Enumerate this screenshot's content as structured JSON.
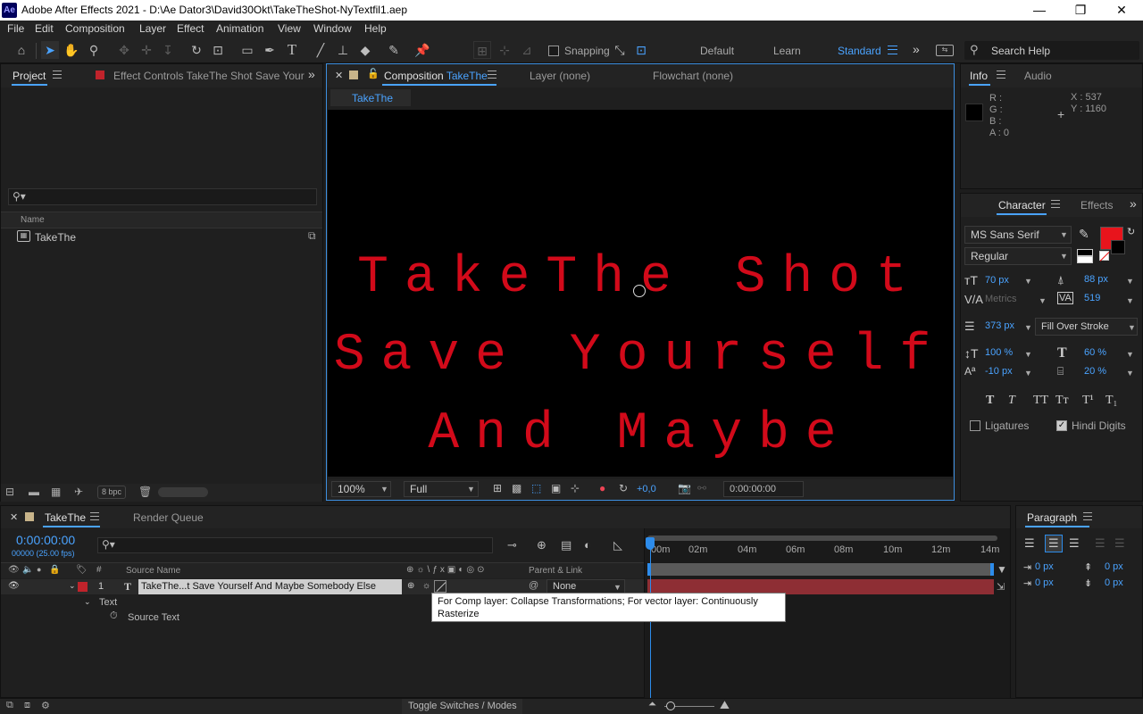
{
  "window": {
    "app_logo": "Ae",
    "title": "Adobe After Effects 2021 - D:\\Ae Dator3\\David30Okt\\TakeTheShot-NyTextfil1.aep",
    "minimize": "—",
    "restore": "❐",
    "close": "✕"
  },
  "menu": [
    "File",
    "Edit",
    "Composition",
    "Layer",
    "Effect",
    "Animation",
    "View",
    "Window",
    "Help"
  ],
  "toolbar": {
    "snapping_label": "Snapping",
    "workspaces": [
      "Default",
      "Learn",
      "Standard"
    ],
    "more": "»",
    "search_placeholder": "Search Help"
  },
  "project_panel": {
    "tab_project": "Project",
    "tab_effect_controls": "Effect Controls TakeThe Shot Save Your",
    "search_placeholder": "",
    "column_name": "Name",
    "items": [
      {
        "name": "TakeThe"
      }
    ],
    "bpc": "8 bpc"
  },
  "composition_panel": {
    "tab_composition_prefix": "Composition",
    "tab_composition_name": "TakeThe",
    "tab_layer": "Layer (none)",
    "tab_flowchart": "Flowchart (none)",
    "breadcrumb": "TakeThe",
    "lines": [
      "TakeThe Shot",
      "Save Yourself",
      "And Maybe"
    ],
    "zoom": "100%",
    "resolution": "Full",
    "exposure": "+0,0",
    "timecode": "0:00:00:00"
  },
  "info_panel": {
    "tab_info": "Info",
    "tab_audio": "Audio",
    "r": "R :",
    "g": "G :",
    "b": "B :",
    "a": "A : 0",
    "x": "X : 537",
    "y": "Y : 1160"
  },
  "character_panel": {
    "tab_character": "Character",
    "tab_effects": "Effects",
    "font_family": "MS Sans Serif",
    "font_style": "Regular",
    "font_size": "70 px",
    "leading": "88 px",
    "kerning": "Metrics",
    "tracking": "519",
    "stroke_width": "373 px",
    "stroke_mode": "Fill Over Stroke",
    "vertical_scale": "100 %",
    "horizontal_scale": "60 %",
    "baseline_shift": "-10 px",
    "tsume": "20 %",
    "styles": [
      "T",
      "T",
      "TT",
      "Tт",
      "T¹",
      "T₁"
    ],
    "ligatures": "Ligatures",
    "hindi_digits": "Hindi Digits",
    "fill_color": "#e8141c"
  },
  "timeline_panel": {
    "tab_comp": "TakeThe",
    "tab_render_queue": "Render Queue",
    "timecode": "0:00:00:00",
    "fps": "00000 (25.00 fps)",
    "col_source_name": "Source Name",
    "col_parent": "Parent & Link",
    "layer_index": "1",
    "layer_name": "TakeThe...t Save Yourself And Maybe Somebody Else",
    "parent_value": "None",
    "prop_text": "Text",
    "prop_source_text": "Source Text",
    "ruler_ticks": [
      "00m",
      "02m",
      "04m",
      "06m",
      "08m",
      "10m",
      "12m",
      "14m"
    ],
    "tooltip": "For Comp layer: Collapse Transformations; For vector layer: Continuously Rasterize",
    "toggle_label": "Toggle Switches / Modes"
  },
  "paragraph_panel": {
    "tab": "Paragraph",
    "indent_left": "0 px",
    "indent_right": "0 px",
    "indent_first": "0 px",
    "space_before": "0 px",
    "space_after": "0 px"
  }
}
